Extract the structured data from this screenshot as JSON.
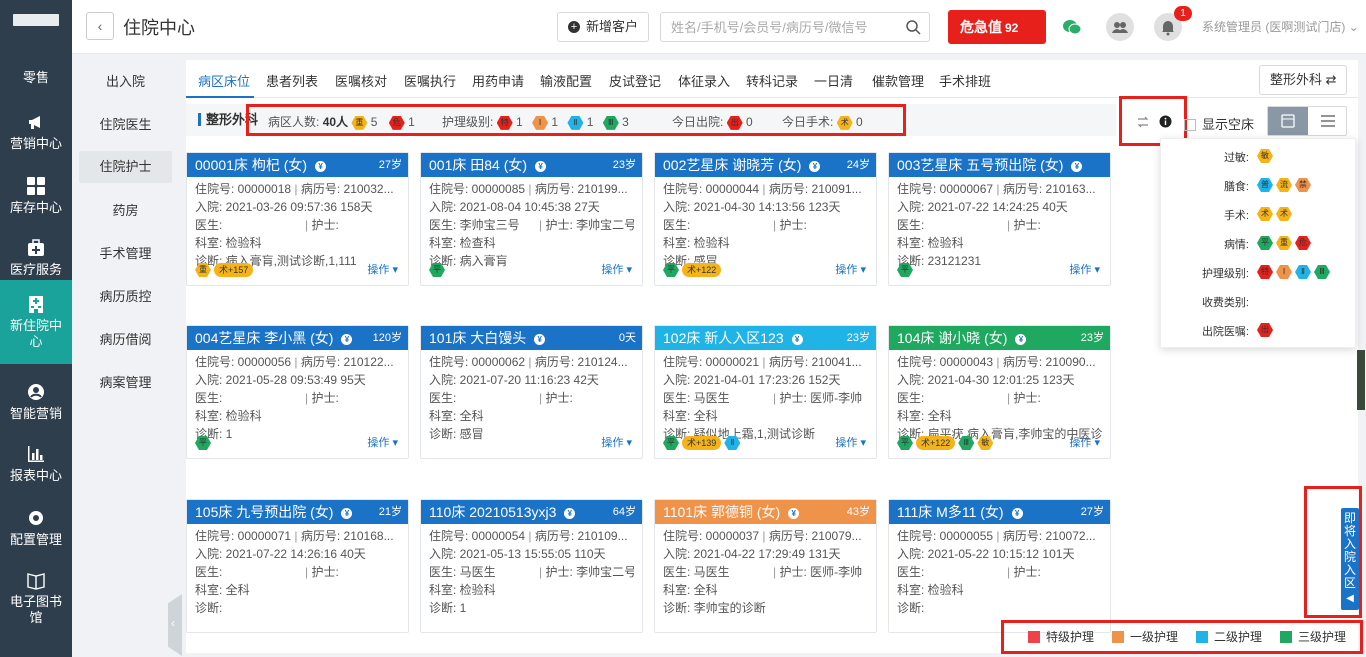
{
  "sidebar": {
    "items": [
      {
        "label": "零售",
        "icon": "retail-icon"
      },
      {
        "label": "营销中心",
        "icon": "megaphone-icon"
      },
      {
        "label": "库存中心",
        "icon": "grid-icon"
      },
      {
        "label": "医疗服务",
        "icon": "medical-kit-icon"
      },
      {
        "label": "新住院中心",
        "icon": "hospital-icon",
        "active": true
      },
      {
        "label": "智能营销",
        "icon": "smart-marketing-icon"
      },
      {
        "label": "报表中心",
        "icon": "bar-chart-icon"
      },
      {
        "label": "配置管理",
        "icon": "gear-icon"
      },
      {
        "label": "电子图书馆",
        "icon": "book-icon"
      }
    ]
  },
  "header": {
    "title": "住院中心",
    "new_customer": "新增客户",
    "search_placeholder": "姓名/手机号/会员号/病历号/微信号",
    "danger_label": "危急值",
    "danger_count": "92",
    "notification_count": "1",
    "user": "系统管理员 (医啊测试门店)"
  },
  "subnav": [
    "出入院",
    "住院医生",
    "住院护士",
    "药房",
    "手术管理",
    "病历质控",
    "病历借阅",
    "病案管理"
  ],
  "tabs": [
    "病区床位",
    "患者列表",
    "医嘱核对",
    "医嘱执行",
    "用药申请",
    "输液配置",
    "皮试登记",
    "体征录入",
    "转科记录",
    "一日清",
    "催款管理",
    "手术排班"
  ],
  "dept_button": "整形外科",
  "filter": {
    "dept": "整形外科",
    "ward_count_label": "病区人数:",
    "ward_count": "40人",
    "c1": "5",
    "c2": "1",
    "nursing_label": "护理级别:",
    "n_te": "1",
    "n_1": "1",
    "n_2": "1",
    "n_3": "3",
    "discharge_label": "今日出院:",
    "discharge": "0",
    "surgery_label": "今日手术:",
    "surgery": "0",
    "show_empty": "显示空床"
  },
  "cards": [
    {
      "title": "00001床 枸杞 (女)",
      "age": "27岁",
      "color": "#1a73c7",
      "l1": "住院号: 00000018",
      "l1b": "病历号: 210032...",
      "l2": "入院: 2021-03-26 09:57:36  158天",
      "doc": "医生:",
      "doc_v": "",
      "nurse": "护士:",
      "nurse_v": "",
      "dept": "科室: 检验科",
      "diag": "诊断: 病入膏肓,测试诊断,1,111",
      "tags": [
        {
          "t": "重",
          "c": "#f5b31a",
          "hex": true
        },
        {
          "t": "术+157",
          "c": "#f5b31a"
        }
      ]
    },
    {
      "title": "001床 田84 (女)",
      "age": "23岁",
      "color": "#1a73c7",
      "l1": "住院号: 00000085",
      "l1b": "病历号: 210199...",
      "l2": "入院: 2021-08-04 10:45:38  27天",
      "doc": "医生:",
      "doc_v": "李帅宝三号",
      "nurse": "护士:",
      "nurse_v": "李帅宝二号",
      "dept": "科室: 检查科",
      "diag": "诊断: 病入膏肓",
      "tags": [
        {
          "t": "平",
          "c": "#1fa85f",
          "hex": true
        }
      ]
    },
    {
      "title": "002艺星床 谢晓芳 (女)",
      "age": "24岁",
      "color": "#1a73c7",
      "l1": "住院号: 00000044",
      "l1b": "病历号: 210091...",
      "l2": "入院: 2021-04-30 14:13:56  123天",
      "doc": "医生:",
      "doc_v": "",
      "nurse": "护士:",
      "nurse_v": "",
      "dept": "科室: 检验科",
      "diag": "诊断: 感冒",
      "tags": [
        {
          "t": "平",
          "c": "#1fa85f",
          "hex": true
        },
        {
          "t": "术+122",
          "c": "#f5b31a"
        }
      ]
    },
    {
      "title": "003艺星床 五号预出院 (女)",
      "age": "",
      "color": "#1a73c7",
      "l1": "住院号: 00000067",
      "l1b": "病历号: 210163...",
      "l2": "入院: 2021-07-22 14:24:25  40天",
      "doc": "医生:",
      "doc_v": "",
      "nurse": "护士:",
      "nurse_v": "",
      "dept": "科室: 检验科",
      "diag": "诊断: 23121231",
      "tags": [
        {
          "t": "平",
          "c": "#1fa85f",
          "hex": true
        }
      ]
    },
    {
      "title": "004艺星床 李小黑 (女)",
      "age": "120岁",
      "color": "#1a73c7",
      "l1": "住院号: 00000056",
      "l1b": "病历号: 210122...",
      "l2": "入院: 2021-05-28 09:53:49  95天",
      "doc": "医生:",
      "doc_v": "",
      "nurse": "护士:",
      "nurse_v": "",
      "dept": "科室: 检验科",
      "diag": "诊断: 1",
      "tags": [
        {
          "t": "平",
          "c": "#1fa85f",
          "hex": true
        }
      ]
    },
    {
      "title": "101床 大白馒头",
      "age": "0天",
      "color": "#1a73c7",
      "l1": "住院号: 00000062",
      "l1b": "病历号: 210124...",
      "l2": "入院: 2021-07-20 11:16:23  42天",
      "doc": "医生:",
      "doc_v": "",
      "nurse": "护士:",
      "nurse_v": "",
      "dept": "科室: 全科",
      "diag": "诊断: 感冒",
      "tags": []
    },
    {
      "title": "102床 新人入区123",
      "age": "23岁",
      "color": "#1fb3e6",
      "l1": "住院号: 00000021",
      "l1b": "病历号: 210041...",
      "l2": "入院: 2021-04-01 17:23:26  152天",
      "doc": "医生:",
      "doc_v": "马医生",
      "nurse": "护士:",
      "nurse_v": "医师-李帅",
      "dept": "科室: 全科",
      "diag": "诊断: 疑似地上霜,1,测试诊断",
      "tags": [
        {
          "t": "平",
          "c": "#1fa85f",
          "hex": true
        },
        {
          "t": "术+139",
          "c": "#f5b31a"
        },
        {
          "t": "Ⅱ",
          "c": "#1fb3e6",
          "hex": true
        }
      ]
    },
    {
      "title": "104床 谢小晓 (女)",
      "age": "23岁",
      "color": "#1fa85f",
      "l1": "住院号: 00000043",
      "l1b": "病历号: 210090...",
      "l2": "入院: 2021-04-30 12:01:25  123天",
      "doc": "医生:",
      "doc_v": "",
      "nurse": "护士:",
      "nurse_v": "",
      "dept": "科室: 全科",
      "diag": "诊断: 扁平疣,病入膏肓,李帅宝的中医诊断",
      "tags": [
        {
          "t": "平",
          "c": "#1fa85f",
          "hex": true
        },
        {
          "t": "术+122",
          "c": "#f5b31a"
        },
        {
          "t": "Ⅲ",
          "c": "#1fa85f",
          "hex": true
        },
        {
          "t": "敏",
          "c": "#f5b31a",
          "hex": true
        }
      ]
    },
    {
      "title": "105床 九号预出院 (女)",
      "age": "21岁",
      "color": "#1a73c7",
      "l1": "住院号: 00000071",
      "l1b": "病历号: 210168...",
      "l2": "入院: 2021-07-22 14:26:16  40天",
      "doc": "医生:",
      "doc_v": "",
      "nurse": "护士:",
      "nurse_v": "",
      "dept": "科室: 全科",
      "diag": "诊断:",
      "tags": []
    },
    {
      "title": "110床 20210513yxj3",
      "age": "64岁",
      "color": "#1a73c7",
      "l1": "住院号: 00000054",
      "l1b": "病历号: 210109...",
      "l2": "入院: 2021-05-13 15:55:05  110天",
      "doc": "医生:",
      "doc_v": "马医生",
      "nurse": "护士:",
      "nurse_v": "李帅宝二号",
      "dept": "科室: 检验科",
      "diag": "诊断: 1",
      "tags": []
    },
    {
      "title": "1101床 郭德铜 (女)",
      "age": "43岁",
      "color": "#f0934a",
      "l1": "住院号: 00000037",
      "l1b": "病历号: 210079...",
      "l2": "入院: 2021-04-22 17:29:49  131天",
      "doc": "医生:",
      "doc_v": "马医生",
      "nurse": "护士:",
      "nurse_v": "医师-李帅",
      "dept": "科室: 全科",
      "diag": "诊断: 李帅宝的诊断",
      "tags": []
    },
    {
      "title": "111床 M多11 (女)",
      "age": "27岁",
      "color": "#1a73c7",
      "l1": "住院号: 00000055",
      "l1b": "病历号: 210072...",
      "l2": "入院: 2021-05-22 10:15:12  101天",
      "doc": "医生:",
      "doc_v": "",
      "nurse": "护士:",
      "nurse_v": "",
      "dept": "科室: 检验科",
      "diag": "诊断:",
      "tags": []
    }
  ],
  "action_label": "操作 ▾",
  "legend_pop": [
    {
      "label": "过敏:",
      "icons": [
        {
          "t": "敏",
          "c": "#f5b31a"
        }
      ]
    },
    {
      "label": "膳食:",
      "icons": [
        {
          "t": "普",
          "c": "#1fb3e6"
        },
        {
          "t": "流",
          "c": "#f5b31a"
        },
        {
          "t": "禁",
          "c": "#f0934a"
        }
      ]
    },
    {
      "label": "手术:",
      "icons": [
        {
          "t": "术",
          "c": "#f5b31a"
        },
        {
          "t": "术",
          "c": "#f5b31a"
        }
      ]
    },
    {
      "label": "病情:",
      "icons": [
        {
          "t": "平",
          "c": "#1fa85f"
        },
        {
          "t": "重",
          "c": "#f5b31a"
        },
        {
          "t": "危",
          "c": "#e8201c"
        }
      ]
    },
    {
      "label": "护理级别:",
      "icons": [
        {
          "t": "特",
          "c": "#e8201c"
        },
        {
          "t": "Ⅰ",
          "c": "#f0934a"
        },
        {
          "t": "Ⅱ",
          "c": "#1fb3e6"
        },
        {
          "t": "Ⅲ",
          "c": "#1fa85f"
        }
      ]
    },
    {
      "label": "收费类别:",
      "icons": []
    },
    {
      "label": "出院医嘱:",
      "icons": [
        {
          "t": "出",
          "c": "#e8201c"
        }
      ]
    }
  ],
  "side_drawer": "即将入院入区",
  "bottom_legend": [
    {
      "label": "特级护理",
      "c": "#f0424a"
    },
    {
      "label": "一级护理",
      "c": "#f0934a"
    },
    {
      "label": "二级护理",
      "c": "#1fb3e6"
    },
    {
      "label": "三级护理",
      "c": "#1fa85f"
    }
  ]
}
